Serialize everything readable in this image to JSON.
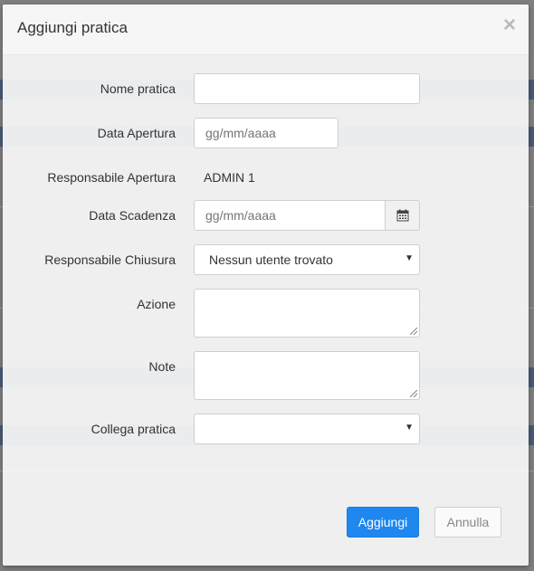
{
  "modal": {
    "title": "Aggiungi pratica",
    "close_symbol": "×"
  },
  "form": {
    "nome_pratica": {
      "label": "Nome pratica",
      "value": ""
    },
    "data_apertura": {
      "label": "Data Apertura",
      "placeholder": "gg/mm/aaaa"
    },
    "responsabile_apertura": {
      "label": "Responsabile Apertura",
      "value": "ADMIN 1"
    },
    "data_scadenza": {
      "label": "Data Scadenza",
      "placeholder": "gg/mm/aaaa",
      "icon": "calendar-icon"
    },
    "responsabile_chiusura": {
      "label": "Responsabile Chiusura",
      "selected": "Nessun utente trovato"
    },
    "azione": {
      "label": "Azione",
      "value": ""
    },
    "note": {
      "label": "Note",
      "value": ""
    },
    "collega_pratica": {
      "label": "Collega pratica",
      "selected": ""
    }
  },
  "footer": {
    "submit_label": "Aggiungi",
    "cancel_label": "Annulla"
  },
  "colors": {
    "primary": "#1e87f0",
    "backdrop": "#7f7f7f",
    "background_band": "#1f3c6d"
  }
}
